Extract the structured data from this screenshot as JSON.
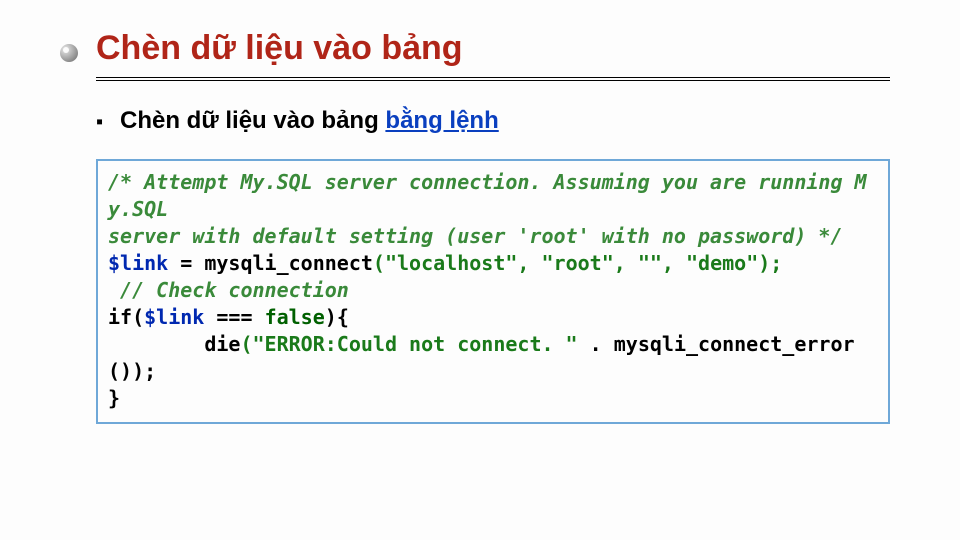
{
  "slide": {
    "title": "Chèn dữ liệu vào bảng",
    "subtitle_prefix": "Chèn dữ liệu vào bảng ",
    "subtitle_link": "bằng lệnh",
    "bullet_char": "▪"
  },
  "code": {
    "comment1": "/* Attempt My.SQL server connection. Assuming you are running My.SQL",
    "comment2": "server with default setting (user 'root' with no password) */",
    "var_link": "$link",
    "eq": " = ",
    "fn_connect": "mysqli_connect",
    "args_connect": "(\"localhost\", \"root\", \"\", \"demo\");",
    "comment3": " // Check connection",
    "if_open": "if(",
    "triple_eq": " === ",
    "false_kw": "false",
    "if_close": "){",
    "indent": "        ",
    "die_fn": "die",
    "die_arg_str": "(\"ERROR:Could not connect. \"",
    "dot": " . ",
    "err_fn": "mysqli_connect_error());",
    "brace_close": "}"
  }
}
